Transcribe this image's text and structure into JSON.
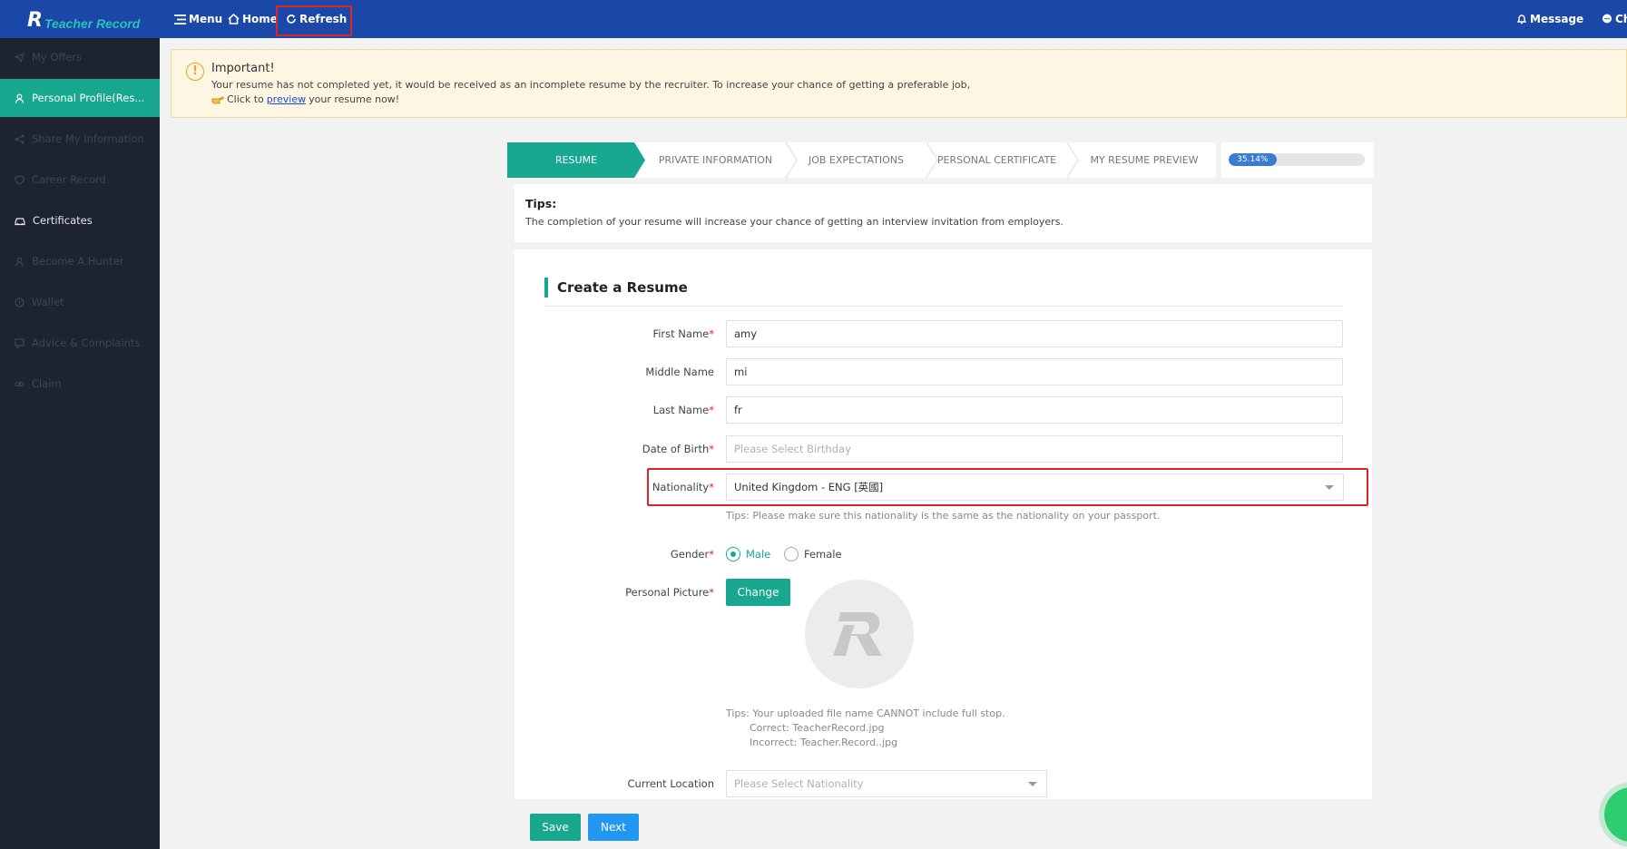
{
  "topbar": {
    "logo_mark": "R",
    "logo_text": "Teacher Record",
    "menu_label": "Menu",
    "home_label": "Home",
    "refresh_label": "Refresh",
    "message_label": "Message",
    "chat_label": "Ch",
    "bg_color": "#1a47a8"
  },
  "sidebar": {
    "items": [
      {
        "label": "My Offers",
        "icon": "send-icon"
      },
      {
        "label": "Personal Profile(Res...",
        "icon": "user-icon"
      },
      {
        "label": "Share My Information",
        "icon": "share-icon"
      },
      {
        "label": "Career Record",
        "icon": "shield-icon"
      },
      {
        "label": "Certificates",
        "icon": "car-icon"
      },
      {
        "label": "Become A Hunter",
        "icon": "person-icon"
      },
      {
        "label": "Wallet",
        "icon": "wallet-icon"
      },
      {
        "label": "Advice & Complaints",
        "icon": "comment-icon"
      },
      {
        "label": "Claim",
        "icon": "link-icon"
      }
    ],
    "active_color": "#17a88f"
  },
  "banner": {
    "icon": "!",
    "title": "Important!",
    "text": "Your resume has not completed yet, it would be received as an incomplete resume by the recruiter. To increase your chance of getting a preferable job,",
    "click_prefix": "Click to",
    "link_text": "preview",
    "click_suffix": "your resume now!"
  },
  "steps": {
    "items": [
      "RESUME",
      "PRIVATE INFORMATION",
      "JOB EXPECTATIONS",
      "PERSONAL CERTIFICATE",
      "MY RESUME PREVIEW"
    ],
    "progress_label": "35.14%",
    "progress_value": 35.14
  },
  "tips": {
    "title": "Tips:",
    "text": "The completion of your resume will increase your chance of getting an interview invitation from employers."
  },
  "form": {
    "section_title": "Create a Resume",
    "first_name_label": "First Name",
    "first_name_value": "amy",
    "middle_name_label": "Middle Name",
    "middle_name_value": "mi",
    "last_name_label": "Last Name",
    "last_name_value": "fr",
    "dob_label": "Date of Birth",
    "dob_placeholder": "Please Select Birthday",
    "nationality_label": "Nationality",
    "nationality_value": "United Kingdom - ENG [英國]",
    "nationality_hint": "Tips: Please make sure this nationality is the same as the nationality on your passport.",
    "gender_label": "Gender",
    "gender_male": "Male",
    "gender_female": "Female",
    "picture_label": "Personal Picture",
    "change_button": "Change",
    "upload_hint_1": "Tips: Your uploaded file name CANNOT include full stop.",
    "upload_hint_2": "Correct: TeacherRecord.jpg",
    "upload_hint_3": "Incorrect: Teacher.Record..jpg",
    "location_label": "Current Location",
    "location_placeholder": "Please Select Nationality",
    "required_mark": "*"
  },
  "actions": {
    "save_label": "Save",
    "next_label": "Next"
  }
}
